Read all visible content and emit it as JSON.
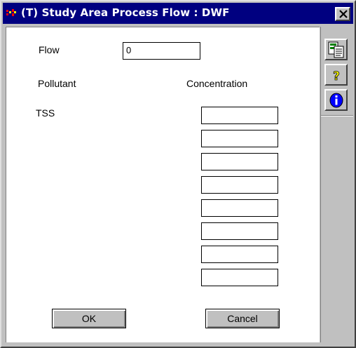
{
  "window": {
    "title": "(T) Study Area Process Flow : DWF",
    "close_icon": "close-icon"
  },
  "form": {
    "flow_label": "Flow",
    "flow_value": "0",
    "pollutant_header": "Pollutant",
    "concentration_header": "Concentration",
    "pollutants": [
      {
        "name": "TSS",
        "concentration": ""
      },
      {
        "name": "",
        "concentration": ""
      },
      {
        "name": "",
        "concentration": ""
      },
      {
        "name": "",
        "concentration": ""
      },
      {
        "name": "",
        "concentration": ""
      },
      {
        "name": "",
        "concentration": ""
      },
      {
        "name": "",
        "concentration": ""
      },
      {
        "name": "",
        "concentration": ""
      }
    ],
    "ok_label": "OK",
    "cancel_label": "Cancel"
  },
  "toolbar": {
    "buttons": [
      {
        "icon": "copy-data-icon"
      },
      {
        "icon": "help-icon"
      },
      {
        "icon": "info-icon"
      }
    ]
  },
  "colors": {
    "titlebar": "#000080",
    "face": "#c0c0c0",
    "client": "#ffffff",
    "help_yellow": "#ffff00",
    "info_blue": "#0000ff"
  }
}
